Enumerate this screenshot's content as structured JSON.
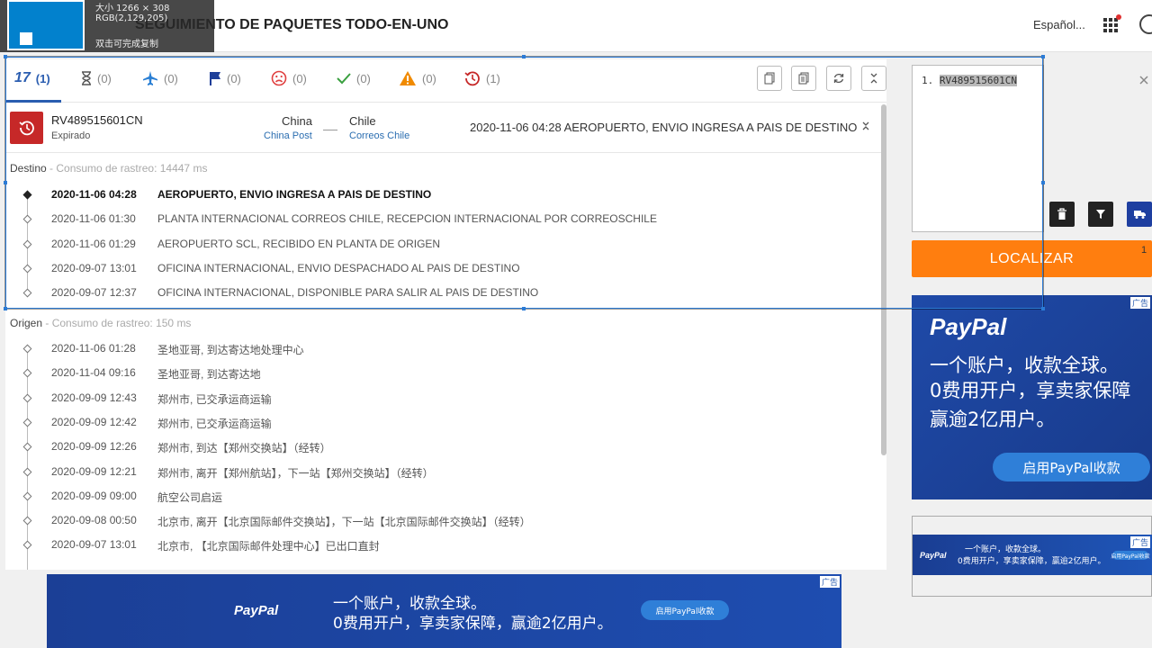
{
  "site": {
    "title": "SEGUIMIENTO DE PAQUETES TODO-EN-UNO",
    "language": "Español...",
    "apps_icon": "grid-icon",
    "user_icon": "user-icon"
  },
  "tabs": [
    {
      "icon": "logo-17-icon",
      "label": "17",
      "count": "(1)",
      "color": "#2a5db0"
    },
    {
      "icon": "hourglass-icon",
      "count": "(0)",
      "color": "#555555"
    },
    {
      "icon": "airplane-icon",
      "count": "(0)",
      "color": "#2a7fd4"
    },
    {
      "icon": "flag-icon",
      "count": "(0)",
      "color": "#1e3f99"
    },
    {
      "icon": "sad-face-icon",
      "count": "(0)",
      "color": "#e04040"
    },
    {
      "icon": "check-icon",
      "count": "(0)",
      "color": "#3aa040"
    },
    {
      "icon": "warning-icon",
      "count": "(0)",
      "color": "#f08a00"
    },
    {
      "icon": "history-icon",
      "count": "(1)",
      "color": "#c62828"
    }
  ],
  "toolbar": [
    "copy-icon",
    "copy-all-icon",
    "refresh-icon",
    "collapse-icon"
  ],
  "package": {
    "number": "RV489515601CN",
    "status": "Expirado",
    "origin_country": "China",
    "origin_carrier": "China Post",
    "dest_country": "Chile",
    "dest_carrier": "Correos Chile",
    "latest": "2020-11-06 04:28  AEROPUERTO, ENVIO INGRESA A PAIS DE DESTINO"
  },
  "destination": {
    "label": "Destino",
    "consumption": " - Consumo de rastreo: 14447 ms",
    "events": [
      {
        "date": "2020-11-06 04:28",
        "desc": "AEROPUERTO, ENVIO INGRESA A PAIS DE DESTINO"
      },
      {
        "date": "2020-11-06 01:30",
        "desc": "PLANTA INTERNACIONAL CORREOS CHILE, RECEPCION INTERNACIONAL POR CORREOSCHILE"
      },
      {
        "date": "2020-11-06 01:29",
        "desc": "AEROPUERTO SCL, RECIBIDO EN PLANTA DE ORIGEN"
      },
      {
        "date": "2020-09-07 13:01",
        "desc": "OFICINA INTERNACIONAL, ENVIO DESPACHADO AL PAIS DE DESTINO"
      },
      {
        "date": "2020-09-07 12:37",
        "desc": "OFICINA INTERNACIONAL, DISPONIBLE PARA SALIR AL PAIS DE DESTINO"
      }
    ]
  },
  "origin": {
    "label": "Origen",
    "consumption": " - Consumo de rastreo: 150 ms",
    "events": [
      {
        "date": "2020-11-06 01:28",
        "desc": "圣地亚哥, 到达寄达地处理中心"
      },
      {
        "date": "2020-11-04 09:16",
        "desc": "圣地亚哥, 到达寄达地"
      },
      {
        "date": "2020-09-09 12:43",
        "desc": "郑州市, 已交承运商运输"
      },
      {
        "date": "2020-09-09 12:42",
        "desc": "郑州市, 已交承运商运输"
      },
      {
        "date": "2020-09-09 12:26",
        "desc": "郑州市, 到达【郑州交换站】（经转）"
      },
      {
        "date": "2020-09-09 12:21",
        "desc": "郑州市, 离开【郑州航站】，下一站【郑州交换站】（经转）"
      },
      {
        "date": "2020-09-09 09:00",
        "desc": "航空公司启运"
      },
      {
        "date": "2020-09-08 00:50",
        "desc": "北京市, 离开【北京国际邮件交换站】，下一站【北京国际邮件交换站】（经转）"
      },
      {
        "date": "2020-09-07 13:01",
        "desc": "北京市, 【北京国际邮件处理中心】已出口直封"
      }
    ]
  },
  "input": {
    "line_number": "1.",
    "value": "RV489515601CN"
  },
  "localizar": {
    "label": "LOCALIZAR",
    "count": "1"
  },
  "ads": {
    "tag": "广告",
    "side": {
      "logo": "PayPal",
      "line1": "一个账户，收款全球。",
      "line2": "0费用开户，享卖家保障",
      "line3": "赢逾2亿用户。",
      "button": "启用PayPal收款"
    },
    "small": {
      "logo": "PayPal",
      "line1": "一个账户，收款全球。",
      "line2": "0费用开户，享卖家保障，赢逾2亿用户。",
      "button": "启用PayPal收款"
    },
    "bottom": {
      "logo": "PayPal",
      "line1": "一个账户，收款全球。",
      "line2": "0费用开户，享卖家保障，赢逾2亿用户。",
      "button": "启用PayPal收款"
    }
  },
  "screenshot_tool": {
    "size": "大小 1266 × 308",
    "rgb": "RGB(2,129,205)",
    "tip": "双击可完成复制"
  }
}
